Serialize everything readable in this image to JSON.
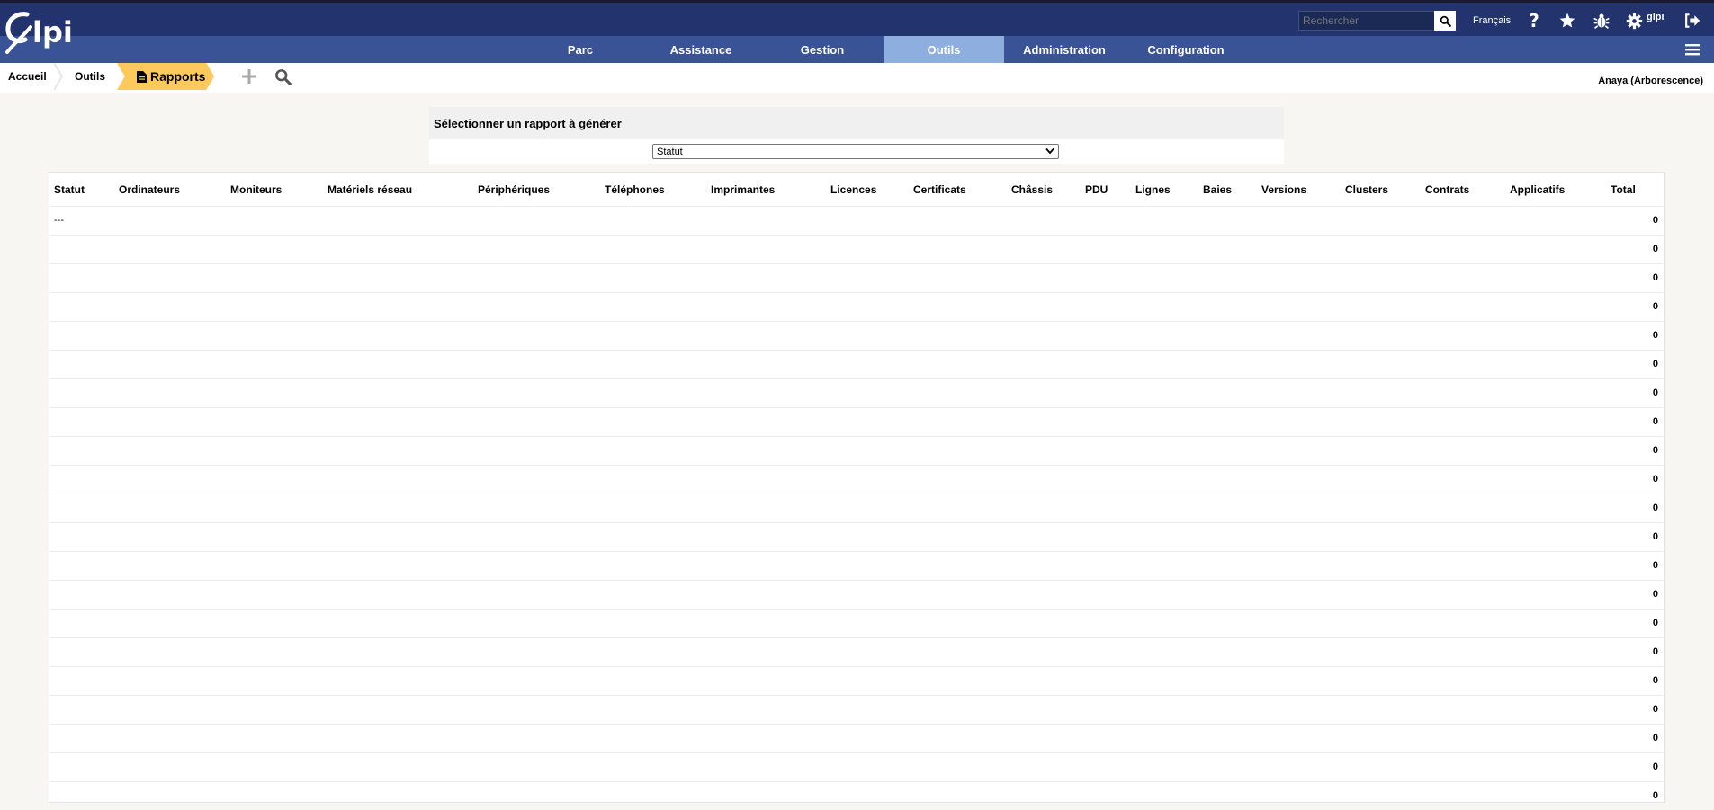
{
  "header": {
    "search_placeholder": "Rechercher",
    "language": "Français",
    "user": "glpi"
  },
  "menu": {
    "items": [
      {
        "label": "Parc"
      },
      {
        "label": "Assistance"
      },
      {
        "label": "Gestion"
      },
      {
        "label": "Outils",
        "active": true
      },
      {
        "label": "Administration"
      },
      {
        "label": "Configuration"
      }
    ]
  },
  "breadcrumb": {
    "home": "Accueil",
    "tools": "Outils",
    "current": "Rapports"
  },
  "entity": "Anaya (Arborescence)",
  "report": {
    "title": "Sélectionner un rapport à générer",
    "selected": "Statut"
  },
  "table": {
    "columns": [
      "Statut",
      "Ordinateurs",
      "Moniteurs",
      "Matériels réseau",
      "Périphériques",
      "Téléphones",
      "Imprimantes",
      "Licences",
      "Certificats",
      "Châssis",
      "PDU",
      "Lignes",
      "Baies",
      "Versions",
      "Clusters",
      "Contrats",
      "Applicatifs",
      "Total"
    ],
    "rows": [
      {
        "label": "---",
        "total": "0"
      },
      {
        "label": "",
        "total": "0"
      },
      {
        "label": "",
        "total": "0"
      },
      {
        "label": "",
        "total": "0"
      },
      {
        "label": "",
        "total": "0"
      },
      {
        "label": "",
        "total": "0"
      },
      {
        "label": "",
        "total": "0"
      },
      {
        "label": "",
        "total": "0"
      },
      {
        "label": "",
        "total": "0"
      },
      {
        "label": "",
        "total": "0"
      },
      {
        "label": "",
        "total": "0"
      },
      {
        "label": "",
        "total": "0"
      },
      {
        "label": "",
        "total": "0"
      },
      {
        "label": "",
        "total": "0"
      },
      {
        "label": "",
        "total": "0"
      },
      {
        "label": "",
        "total": "0"
      },
      {
        "label": "",
        "total": "0"
      },
      {
        "label": "",
        "total": "0"
      },
      {
        "label": "",
        "total": "0"
      },
      {
        "label": "",
        "total": "0"
      },
      {
        "label": "",
        "total": "0"
      }
    ]
  }
}
